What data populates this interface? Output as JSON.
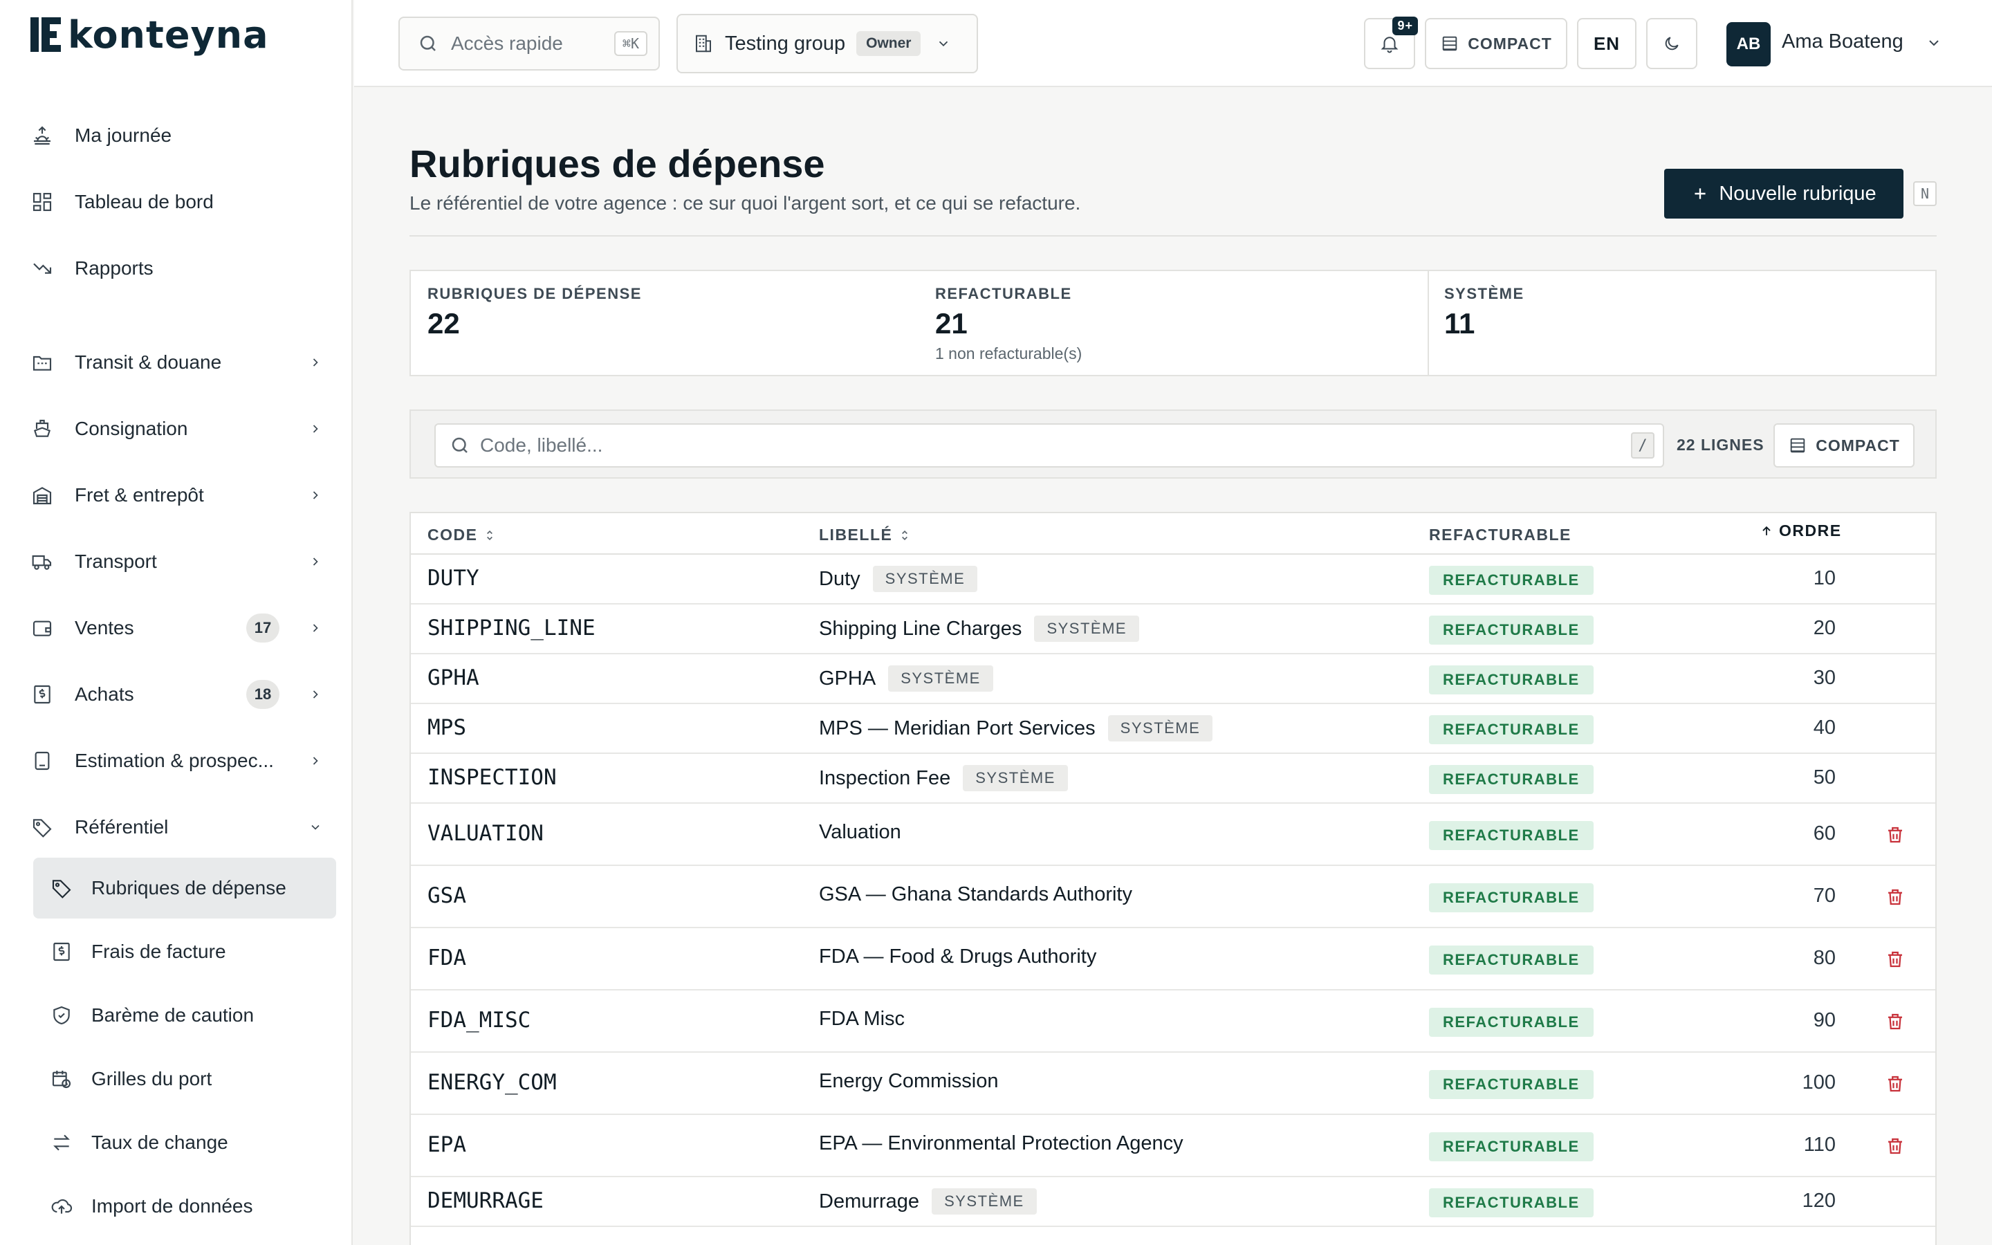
{
  "brand": {
    "logo_text": "konteyna"
  },
  "sidebar": {
    "top": [
      {
        "label": "Ma journée",
        "icon": "sunrise-icon"
      },
      {
        "label": "Tableau de bord",
        "icon": "dashboard-icon"
      },
      {
        "label": "Rapports",
        "icon": "trend-icon"
      }
    ],
    "sections": [
      {
        "label": "Transit & douane",
        "icon": "customs-icon",
        "count": ""
      },
      {
        "label": "Consignation",
        "icon": "ship-icon",
        "count": ""
      },
      {
        "label": "Fret & entrepôt",
        "icon": "warehouse-icon",
        "count": ""
      },
      {
        "label": "Transport",
        "icon": "truck-icon",
        "count": ""
      },
      {
        "label": "Ventes",
        "icon": "wallet-icon",
        "count": "17"
      },
      {
        "label": "Achats",
        "icon": "receipt-icon",
        "count": "18"
      },
      {
        "label": "Estimation & prospec...",
        "icon": "calculator-icon",
        "count": ""
      },
      {
        "label": "Référentiel",
        "icon": "tag-icon",
        "count": ""
      }
    ],
    "sub": [
      {
        "label": "Rubriques de dépense",
        "icon": "tag-icon",
        "active": true
      },
      {
        "label": "Frais de facture",
        "icon": "invoice-icon"
      },
      {
        "label": "Barème de caution",
        "icon": "shield-icon"
      },
      {
        "label": "Grilles du port",
        "icon": "calendar-clock-icon"
      },
      {
        "label": "Taux de change",
        "icon": "exchange-icon"
      },
      {
        "label": "Import de données",
        "icon": "cloud-upload-icon"
      }
    ]
  },
  "topbar": {
    "quick_placeholder": "Accès rapide",
    "quick_kbd": "⌘K",
    "group_name": "Testing group",
    "group_role": "Owner",
    "notif_badge": "9+",
    "compact_label": "COMPACT",
    "lang": "EN",
    "user_initials": "AB",
    "user_name": "Ama Boateng"
  },
  "page": {
    "title": "Rubriques de dépense",
    "subtitle": "Le référentiel de votre agence : ce sur quoi l'argent sort, et ce qui se refacture.",
    "new_button": "Nouvelle rubrique",
    "new_kbd": "N"
  },
  "stats": {
    "total_label": "RUBRIQUES DE DÉPENSE",
    "total_value": "22",
    "refac_label": "REFACTURABLE",
    "refac_value": "21",
    "refac_note": "1 non refacturable(s)",
    "system_label": "SYSTÈME",
    "system_value": "11"
  },
  "filter": {
    "search_placeholder": "Code, libellé...",
    "search_kbd": "/",
    "rows_count": "22 LIGNES",
    "compact_label": "COMPACT"
  },
  "table": {
    "headers": {
      "code": "CODE",
      "label": "LIBELLÉ",
      "refac": "REFACTURABLE",
      "order": "ORDRE"
    },
    "system_tag": "SYSTÈME",
    "refac_tag": "REFACTURABLE",
    "rows": [
      {
        "code": "DUTY",
        "label": "Duty",
        "system": true,
        "order": "10"
      },
      {
        "code": "SHIPPING_LINE",
        "label": "Shipping Line Charges",
        "system": true,
        "order": "20"
      },
      {
        "code": "GPHA",
        "label": "GPHA",
        "system": true,
        "order": "30"
      },
      {
        "code": "MPS",
        "label": "MPS — Meridian Port Services",
        "system": true,
        "order": "40"
      },
      {
        "code": "INSPECTION",
        "label": "Inspection Fee",
        "system": true,
        "order": "50"
      },
      {
        "code": "VALUATION",
        "label": "Valuation",
        "system": false,
        "order": "60"
      },
      {
        "code": "GSA",
        "label": "GSA — Ghana Standards Authority",
        "system": false,
        "order": "70"
      },
      {
        "code": "FDA",
        "label": "FDA — Food & Drugs Authority",
        "system": false,
        "order": "80"
      },
      {
        "code": "FDA_MISC",
        "label": "FDA Misc",
        "system": false,
        "order": "90"
      },
      {
        "code": "ENERGY_COM",
        "label": "Energy Commission",
        "system": false,
        "order": "100"
      },
      {
        "code": "EPA",
        "label": "EPA — Environmental Protection Agency",
        "system": false,
        "order": "110"
      },
      {
        "code": "DEMURRAGE",
        "label": "Demurrage",
        "system": true,
        "order": "120"
      }
    ]
  },
  "colors": {
    "brand": "#0f2836",
    "refac_bg": "#def2e6",
    "refac_fg": "#1f7a48",
    "danger": "#c8313a"
  }
}
